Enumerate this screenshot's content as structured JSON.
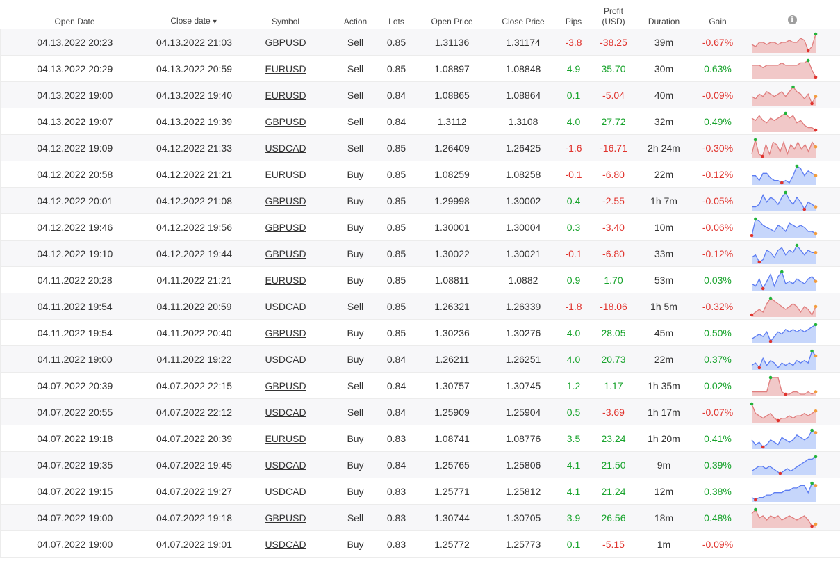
{
  "headers": {
    "open_date": "Open Date",
    "close_date": "Close date",
    "sort_arrow": "▼",
    "symbol": "Symbol",
    "action": "Action",
    "lots": "Lots",
    "open_price": "Open Price",
    "close_price": "Close Price",
    "pips": "Pips",
    "profit_line1": "Profit",
    "profit_line2": "(USD)",
    "duration": "Duration",
    "gain": "Gain",
    "info": "i"
  },
  "colors": {
    "positive": "#18a32c",
    "negative": "#e0332d",
    "sell_fill": "#f1c8c8",
    "buy_fill": "#c6d6fb"
  },
  "rows": [
    {
      "open": "04.13.2022 20:23",
      "close": "04.13.2022 21:03",
      "symbol": "GBPUSD",
      "action": "Sell",
      "lots": "0.85",
      "open_price": "1.31136",
      "close_price": "1.31174",
      "pips": "-3.8",
      "profit": "-38.25",
      "duration": "39m",
      "gain": "-0.67%",
      "spark": [
        3,
        2,
        4,
        4,
        3,
        4,
        4,
        3,
        4,
        4,
        5,
        4,
        4,
        6,
        5,
        0,
        2,
        8
      ]
    },
    {
      "open": "04.13.2022 20:29",
      "close": "04.13.2022 20:59",
      "symbol": "EURUSD",
      "action": "Sell",
      "lots": "0.85",
      "open_price": "1.08897",
      "close_price": "1.08848",
      "pips": "4.9",
      "profit": "35.70",
      "duration": "30m",
      "gain": "0.63%",
      "spark": [
        5,
        5,
        5,
        4,
        5,
        5,
        5,
        5,
        6,
        5,
        5,
        5,
        5,
        6,
        6,
        7,
        3,
        0
      ]
    },
    {
      "open": "04.13.2022 19:00",
      "close": "04.13.2022 19:40",
      "symbol": "EURUSD",
      "action": "Sell",
      "lots": "0.84",
      "open_price": "1.08865",
      "close_price": "1.08864",
      "pips": "0.1",
      "profit": "-5.04",
      "duration": "40m",
      "gain": "-0.09%",
      "spark": [
        4,
        3,
        5,
        4,
        6,
        5,
        4,
        5,
        6,
        4,
        6,
        8,
        6,
        5,
        3,
        5,
        1,
        4
      ]
    },
    {
      "open": "04.13.2022 19:07",
      "close": "04.13.2022 19:39",
      "symbol": "GBPUSD",
      "action": "Sell",
      "lots": "0.84",
      "open_price": "1.3112",
      "close_price": "1.3108",
      "pips": "4.0",
      "profit": "27.72",
      "duration": "32m",
      "gain": "0.49%",
      "spark": [
        6,
        5,
        7,
        5,
        4,
        6,
        5,
        6,
        7,
        8,
        6,
        7,
        4,
        5,
        3,
        2,
        2,
        1
      ]
    },
    {
      "open": "04.12.2022 19:09",
      "close": "04.12.2022 21:33",
      "symbol": "USDCAD",
      "action": "Sell",
      "lots": "0.85",
      "open_price": "1.26409",
      "close_price": "1.26425",
      "pips": "-1.6",
      "profit": "-16.71",
      "duration": "2h 24m",
      "gain": "-0.30%",
      "spark": [
        2,
        8,
        2,
        1,
        6,
        2,
        7,
        6,
        3,
        7,
        2,
        6,
        4,
        7,
        4,
        6,
        3,
        7,
        5
      ]
    },
    {
      "open": "04.12.2022 20:58",
      "close": "04.12.2022 21:21",
      "symbol": "EURUSD",
      "action": "Buy",
      "lots": "0.85",
      "open_price": "1.08259",
      "close_price": "1.08258",
      "pips": "-0.1",
      "profit": "-6.80",
      "duration": "22m",
      "gain": "-0.12%",
      "spark": [
        4,
        4,
        2,
        5,
        5,
        3,
        2,
        2,
        1,
        2,
        1,
        4,
        8,
        7,
        4,
        6,
        5,
        4
      ]
    },
    {
      "open": "04.12.2022 20:01",
      "close": "04.12.2022 21:08",
      "symbol": "GBPUSD",
      "action": "Buy",
      "lots": "0.85",
      "open_price": "1.29998",
      "close_price": "1.30002",
      "pips": "0.4",
      "profit": "-2.55",
      "duration": "1h 7m",
      "gain": "-0.05%",
      "spark": [
        2,
        2,
        3,
        7,
        4,
        6,
        5,
        3,
        6,
        8,
        5,
        3,
        6,
        4,
        1,
        4,
        3,
        2
      ]
    },
    {
      "open": "04.12.2022 19:46",
      "close": "04.12.2022 19:56",
      "symbol": "GBPUSD",
      "action": "Buy",
      "lots": "0.85",
      "open_price": "1.30001",
      "close_price": "1.30004",
      "pips": "0.3",
      "profit": "-3.40",
      "duration": "10m",
      "gain": "-0.06%",
      "spark": [
        0,
        8,
        7,
        5,
        4,
        3,
        2,
        5,
        4,
        2,
        6,
        5,
        4,
        5,
        4,
        2,
        2,
        1
      ]
    },
    {
      "open": "04.12.2022 19:10",
      "close": "04.12.2022 19:44",
      "symbol": "GBPUSD",
      "action": "Buy",
      "lots": "0.85",
      "open_price": "1.30022",
      "close_price": "1.30021",
      "pips": "-0.1",
      "profit": "-6.80",
      "duration": "33m",
      "gain": "-0.12%",
      "spark": [
        3,
        4,
        1,
        2,
        6,
        5,
        3,
        6,
        7,
        4,
        6,
        5,
        8,
        6,
        4,
        6,
        5,
        5
      ]
    },
    {
      "open": "04.11.2022 20:28",
      "close": "04.11.2022 21:21",
      "symbol": "EURUSD",
      "action": "Buy",
      "lots": "0.85",
      "open_price": "1.08811",
      "close_price": "1.0882",
      "pips": "0.9",
      "profit": "1.70",
      "duration": "53m",
      "gain": "0.03%",
      "spark": [
        3,
        2,
        5,
        1,
        4,
        7,
        2,
        6,
        8,
        3,
        4,
        3,
        5,
        4,
        3,
        5,
        6,
        4
      ]
    },
    {
      "open": "04.11.2022 19:54",
      "close": "04.11.2022 20:59",
      "symbol": "USDCAD",
      "action": "Sell",
      "lots": "0.85",
      "open_price": "1.26321",
      "close_price": "1.26339",
      "pips": "-1.8",
      "profit": "-18.06",
      "duration": "1h 5m",
      "gain": "-0.32%",
      "spark": [
        2,
        3,
        4,
        3,
        6,
        8,
        7,
        6,
        5,
        4,
        5,
        6,
        5,
        3,
        5,
        4,
        2,
        5
      ]
    },
    {
      "open": "04.11.2022 19:54",
      "close": "04.11.2022 20:40",
      "symbol": "GBPUSD",
      "action": "Buy",
      "lots": "0.85",
      "open_price": "1.30236",
      "close_price": "1.30276",
      "pips": "4.0",
      "profit": "28.05",
      "duration": "45m",
      "gain": "0.50%",
      "spark": [
        2,
        3,
        4,
        3,
        5,
        1,
        3,
        5,
        4,
        6,
        5,
        6,
        5,
        6,
        5,
        6,
        7,
        8
      ]
    },
    {
      "open": "04.11.2022 19:00",
      "close": "04.11.2022 19:22",
      "symbol": "USDCAD",
      "action": "Buy",
      "lots": "0.84",
      "open_price": "1.26211",
      "close_price": "1.26251",
      "pips": "4.0",
      "profit": "20.73",
      "duration": "22m",
      "gain": "0.37%",
      "spark": [
        2,
        3,
        1,
        5,
        2,
        4,
        3,
        1,
        3,
        2,
        3,
        2,
        4,
        3,
        4,
        3,
        8,
        6
      ]
    },
    {
      "open": "04.07.2022 20:39",
      "close": "04.07.2022 22:15",
      "symbol": "GBPUSD",
      "action": "Sell",
      "lots": "0.84",
      "open_price": "1.30757",
      "close_price": "1.30745",
      "pips": "1.2",
      "profit": "1.17",
      "duration": "1h 35m",
      "gain": "0.02%",
      "spark": [
        2,
        2,
        2,
        2,
        2,
        8,
        8,
        8,
        2,
        1,
        1,
        2,
        2,
        1,
        1,
        2,
        1,
        2
      ]
    },
    {
      "open": "04.07.2022 20:55",
      "close": "04.07.2022 22:12",
      "symbol": "USDCAD",
      "action": "Sell",
      "lots": "0.84",
      "open_price": "1.25909",
      "close_price": "1.25904",
      "pips": "0.5",
      "profit": "-3.69",
      "duration": "1h 17m",
      "gain": "-0.07%",
      "spark": [
        8,
        4,
        3,
        2,
        3,
        4,
        2,
        1,
        2,
        2,
        3,
        2,
        3,
        3,
        4,
        3,
        4,
        5
      ]
    },
    {
      "open": "04.07.2022 19:18",
      "close": "04.07.2022 20:39",
      "symbol": "EURUSD",
      "action": "Buy",
      "lots": "0.83",
      "open_price": "1.08741",
      "close_price": "1.08776",
      "pips": "3.5",
      "profit": "23.24",
      "duration": "1h 20m",
      "gain": "0.41%",
      "spark": [
        4,
        2,
        3,
        1,
        2,
        4,
        3,
        2,
        5,
        4,
        3,
        4,
        6,
        5,
        4,
        5,
        8,
        7
      ]
    },
    {
      "open": "04.07.2022 19:35",
      "close": "04.07.2022 19:45",
      "symbol": "USDCAD",
      "action": "Buy",
      "lots": "0.84",
      "open_price": "1.25765",
      "close_price": "1.25806",
      "pips": "4.1",
      "profit": "21.50",
      "duration": "9m",
      "gain": "0.39%",
      "spark": [
        2,
        3,
        4,
        4,
        3,
        4,
        3,
        2,
        1,
        2,
        3,
        2,
        3,
        4,
        5,
        6,
        7,
        7,
        8
      ]
    },
    {
      "open": "04.07.2022 19:15",
      "close": "04.07.2022 19:27",
      "symbol": "USDCAD",
      "action": "Buy",
      "lots": "0.83",
      "open_price": "1.25771",
      "close_price": "1.25812",
      "pips": "4.1",
      "profit": "21.24",
      "duration": "12m",
      "gain": "0.38%",
      "spark": [
        1,
        0,
        1,
        1,
        2,
        2,
        3,
        3,
        3,
        4,
        4,
        5,
        5,
        6,
        6,
        3,
        7,
        6
      ]
    },
    {
      "open": "04.07.2022 19:00",
      "close": "04.07.2022 19:18",
      "symbol": "GBPUSD",
      "action": "Sell",
      "lots": "0.83",
      "open_price": "1.30744",
      "close_price": "1.30705",
      "pips": "3.9",
      "profit": "26.56",
      "duration": "18m",
      "gain": "0.48%",
      "spark": [
        6,
        8,
        4,
        5,
        3,
        5,
        4,
        5,
        3,
        4,
        5,
        4,
        3,
        4,
        5,
        3,
        0,
        1
      ]
    },
    {
      "open": "04.07.2022 19:00",
      "close": "04.07.2022 19:01",
      "symbol": "USDCAD",
      "action": "Buy",
      "lots": "0.83",
      "open_price": "1.25772",
      "close_price": "1.25773",
      "pips": "0.1",
      "profit": "-5.15",
      "duration": "1m",
      "gain": "-0.09%",
      "spark": []
    }
  ]
}
